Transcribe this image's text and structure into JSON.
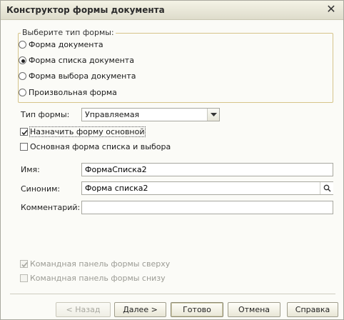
{
  "window": {
    "title": "Конструктор формы документа"
  },
  "form_type_group": {
    "legend": "Выберите тип формы:",
    "options": [
      {
        "label": "Форма документа",
        "checked": false
      },
      {
        "label": "Форма списка документа",
        "checked": true
      },
      {
        "label": "Форма выбора документа",
        "checked": false
      },
      {
        "label": "Произвольная форма",
        "checked": false
      }
    ]
  },
  "form_kind": {
    "label": "Тип формы:",
    "value": "Управляемая"
  },
  "checkboxes": {
    "main_form": {
      "label": "Назначить форму основной",
      "checked": true
    },
    "list_choice_form": {
      "label": "Основная форма списка и выбора",
      "checked": false
    }
  },
  "fields": {
    "name": {
      "label": "Имя:",
      "value": "ФормаСписка2"
    },
    "synonym": {
      "label": "Синоним:",
      "value": "Форма списка2"
    },
    "comment": {
      "label": "Комментарий:",
      "value": ""
    }
  },
  "panels": {
    "top": {
      "label": "Командная панель формы сверху",
      "checked": true,
      "enabled": false
    },
    "bottom": {
      "label": "Командная панель формы снизу",
      "checked": false,
      "enabled": false
    }
  },
  "buttons": {
    "back": "< Назад",
    "next": "Далее >",
    "done": "Готово",
    "cancel": "Отмена",
    "help": "Справка"
  },
  "icons": {
    "close": "close-icon",
    "dropdown": "triangle-down-icon",
    "search": "magnifier-icon",
    "check": "checkmark-icon"
  }
}
